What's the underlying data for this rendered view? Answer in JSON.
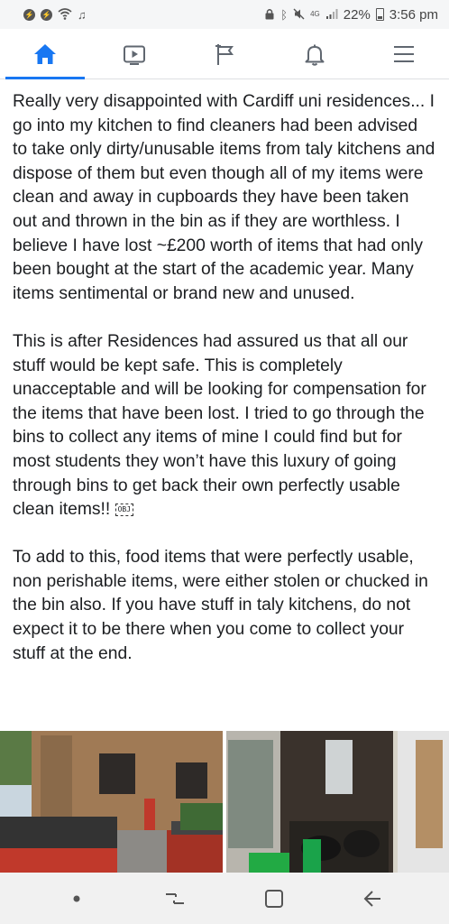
{
  "status_bar": {
    "battery": "22%",
    "time": "3:56 pm",
    "left_icons": [
      "messenger-icon",
      "messenger-icon",
      "wifi-icon",
      "music-icon"
    ],
    "right_icons": [
      "lock-icon",
      "bluetooth-icon",
      "mute-icon",
      "data-icon",
      "signal-icon",
      "battery-icon"
    ]
  },
  "nav": {
    "tabs": [
      {
        "icon": "home-icon",
        "active": true
      },
      {
        "icon": "video-icon",
        "active": false
      },
      {
        "icon": "flag-icon",
        "active": false
      },
      {
        "icon": "bell-icon",
        "active": false
      },
      {
        "icon": "menu-icon",
        "active": false
      }
    ],
    "accent": "#1877f2"
  },
  "post": {
    "paragraph_1": "Really very disappointed with Cardiff uni residences... I go into my kitchen to find cleaners had been advised to take only dirty/unusable items from taly kitchens and dispose of them but even though all of my items were clean and away in cupboards they have been taken out and thrown in the bin as if they are worthless. I believe I have lost ~£200 worth of items that had only been bought at the start of the academic year. Many items sentimental or brand new and unused.",
    "paragraph_2": "This is after Residences had assured us that all our stuff would be kept safe. This is completely unacceptable and will be looking for compensation for the items that have been lost. I tried to go through the bins to collect any items of mine I could find but for most students they won’t have this luxury of going through bins to get back their own perfectly usable clean items!!",
    "obj_marker": "OBJ",
    "paragraph_3": "To add to this, food items that were perfectly usable, non perishable items, were either stolen or chucked in the bin also. If you have stuff in taly kitchens, do not expect it to be there when you come to collect your stuff at the end."
  },
  "system_nav": {
    "buttons": [
      "dot-icon",
      "recent-apps-icon",
      "home-square-icon",
      "back-icon"
    ]
  }
}
